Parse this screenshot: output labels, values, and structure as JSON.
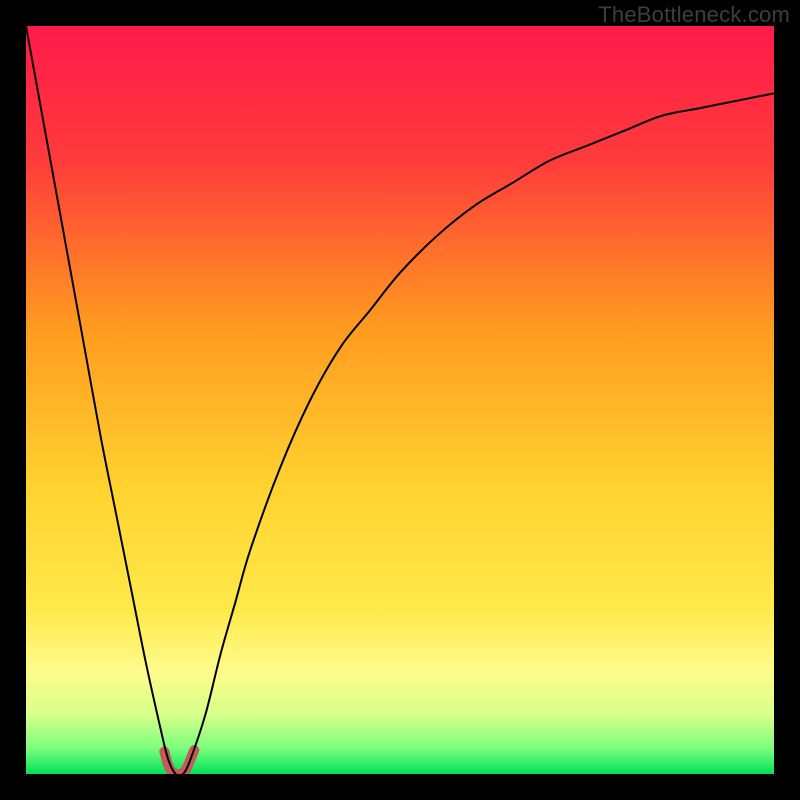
{
  "watermark": "TheBottleneck.com",
  "chart_data": {
    "type": "line",
    "title": "",
    "xlabel": "",
    "ylabel": "",
    "xlim": [
      0,
      100
    ],
    "ylim": [
      0,
      100
    ],
    "grid": false,
    "legend": false,
    "background_gradient_stops": [
      {
        "offset": 0.0,
        "color": "#ff1a4b"
      },
      {
        "offset": 0.18,
        "color": "#ff3b3b"
      },
      {
        "offset": 0.4,
        "color": "#ff9a1f"
      },
      {
        "offset": 0.62,
        "color": "#ffd330"
      },
      {
        "offset": 0.78,
        "color": "#ffe94a"
      },
      {
        "offset": 0.86,
        "color": "#fffb8a"
      },
      {
        "offset": 0.92,
        "color": "#d9ff8a"
      },
      {
        "offset": 0.965,
        "color": "#7dff7d"
      },
      {
        "offset": 1.0,
        "color": "#00e05a"
      }
    ],
    "series": [
      {
        "name": "bottleneck-curve",
        "color": "#000000",
        "width": 2,
        "x": [
          0,
          2,
          4,
          6,
          8,
          10,
          12,
          14,
          16,
          18,
          19,
          20,
          21,
          22,
          24,
          26,
          28,
          30,
          34,
          38,
          42,
          46,
          50,
          55,
          60,
          65,
          70,
          75,
          80,
          85,
          90,
          95,
          100
        ],
        "y": [
          100,
          89,
          78,
          67,
          56,
          45,
          35,
          25,
          15,
          6,
          2,
          0,
          0,
          2,
          8,
          16,
          23,
          30,
          41,
          50,
          57,
          62,
          67,
          72,
          76,
          79,
          82,
          84,
          86,
          88,
          89,
          90,
          91
        ]
      },
      {
        "name": "minimum-highlight",
        "color": "#c55a5a",
        "width": 10,
        "x": [
          18.5,
          19,
          19.5,
          20,
          20.5,
          21,
          21.5,
          22,
          22.5
        ],
        "y": [
          3,
          1.2,
          0.3,
          0,
          0,
          0.2,
          0.8,
          2,
          3.2
        ]
      }
    ]
  }
}
